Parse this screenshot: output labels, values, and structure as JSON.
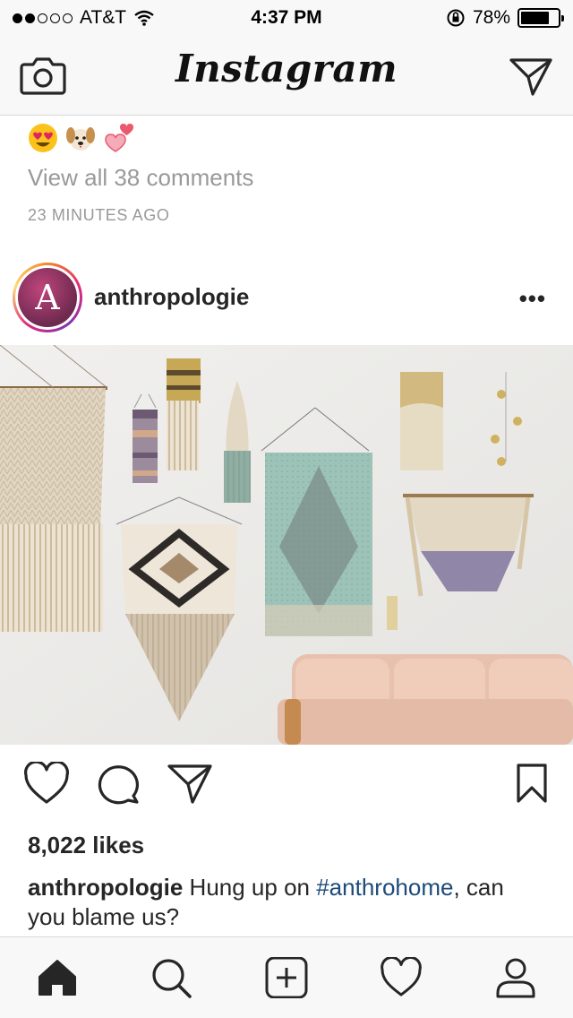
{
  "status_bar": {
    "carrier": "AT&T",
    "time": "4:37 PM",
    "battery": "78%",
    "battery_level": 0.78,
    "signal_dots": [
      true,
      true,
      false,
      false,
      false
    ]
  },
  "nav": {
    "title": "Instagram",
    "camera_icon": "camera-icon",
    "direct_icon": "paper-plane-icon"
  },
  "previous_post": {
    "emojis": [
      "heart-eyes-face",
      "dog-face",
      "two-hearts"
    ],
    "view_comments": "View all 38 comments",
    "timestamp": "23 MINUTES AGO"
  },
  "post": {
    "avatar_letter": "A",
    "username": "anthropologie",
    "more": "•••",
    "likes": "8,022 likes",
    "caption": {
      "user": "anthropologie",
      "text_before": " Hung up on ",
      "hashtag": "#anthrohome",
      "text_after": ", can you blame us?"
    }
  },
  "tab_bar": {
    "items": [
      "home-icon",
      "search-icon",
      "add-post-icon",
      "activity-heart-icon",
      "profile-icon"
    ]
  },
  "colors": {
    "bar_bg": "#f8f8f8",
    "text": "#262626",
    "muted": "#999999",
    "hashtag": "#1c4b7a"
  }
}
